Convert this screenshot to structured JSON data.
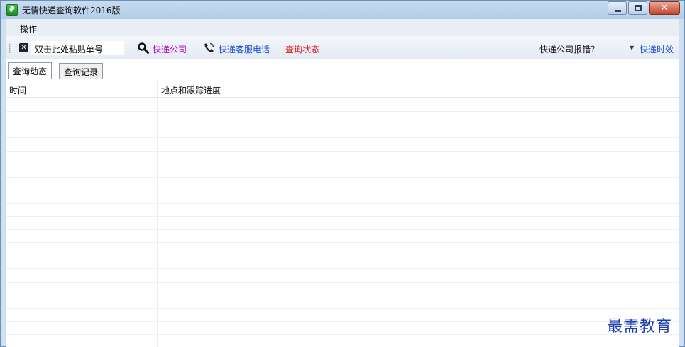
{
  "window": {
    "title": "无情快递查询软件2016版",
    "icon": "app-icon",
    "controls": [
      "minimize-icon",
      "maximize-icon",
      "close-icon"
    ]
  },
  "menu": {
    "items": [
      {
        "label": "操作"
      }
    ]
  },
  "toolbar": {
    "paste_field_value": "双击此处粘贴单号",
    "clear_icon": "clear-icon",
    "search_icon": "search-icon",
    "express_company": "快递公司",
    "phone_icon": "phone-icon",
    "service_phone": "快递客服电话",
    "query_status": "查询状态",
    "complain": "快递公司报错？",
    "timeliness": "快递时效",
    "colors": {
      "express_company": "#b000c0",
      "service_phone": "#1a4fd6",
      "query_status": "#e01010"
    }
  },
  "tabs": [
    {
      "label": "查询动态",
      "active": true
    },
    {
      "label": "查询记录",
      "active": false
    }
  ],
  "grid": {
    "columns": [
      "时间",
      "地点和跟踪进度"
    ],
    "rows": []
  },
  "watermark": "最需教育"
}
